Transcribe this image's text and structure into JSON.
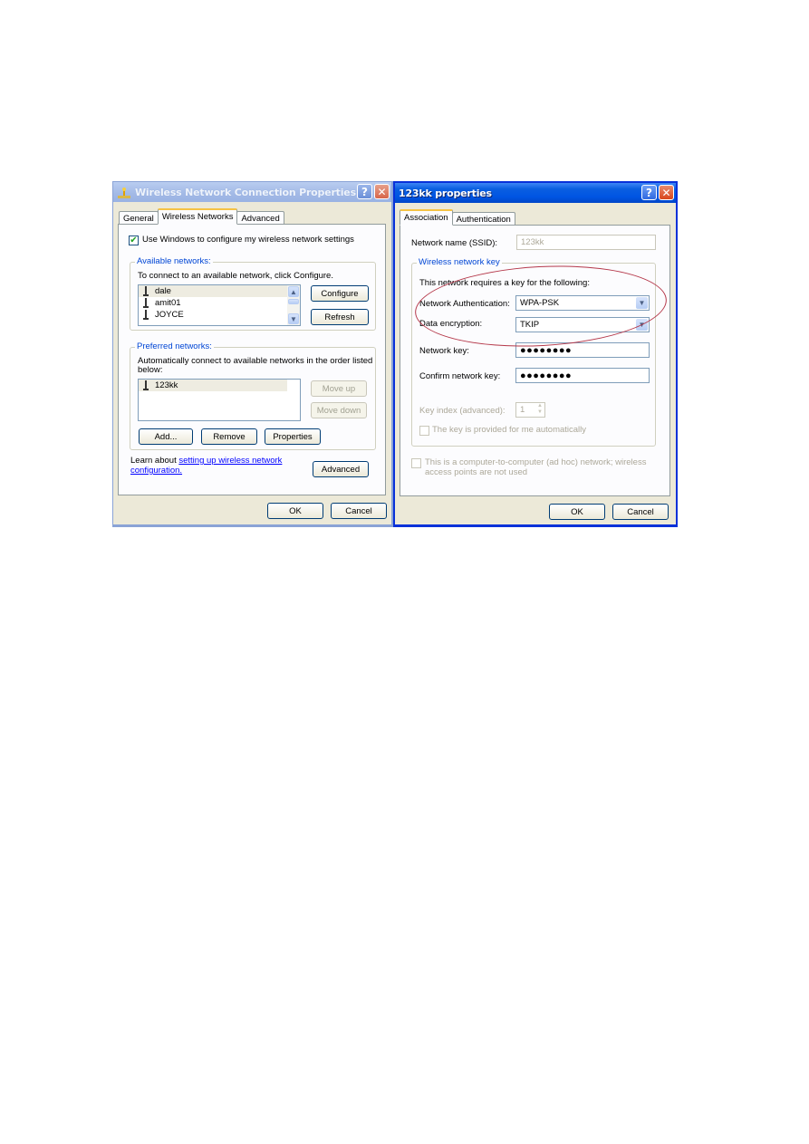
{
  "left_dialog": {
    "title": "Wireless Network Connection Properties",
    "help_label": "?",
    "close_label": "✕",
    "icon": "network-icon",
    "tabs": [
      {
        "label": "General",
        "active": false
      },
      {
        "label": "Wireless Networks",
        "active": true
      },
      {
        "label": "Advanced",
        "active": false
      }
    ],
    "use_windows_checkbox": {
      "label": "Use Windows to configure my wireless network settings",
      "checked": true,
      "mark": "✔"
    },
    "available": {
      "legend": "Available networks:",
      "description": "To connect to an available network, click Configure.",
      "networks": [
        "dale",
        "amit01",
        "JOYCE"
      ],
      "selected_index": 0,
      "configure_label": "Configure",
      "refresh_label": "Refresh"
    },
    "preferred": {
      "legend": "Preferred networks:",
      "description_line1": "Automatically connect to available networks in the order listed",
      "description_line2": "below:",
      "networks": [
        "123kk"
      ],
      "move_up_label": "Move up",
      "move_down_label": "Move down",
      "add_label": "Add...",
      "remove_label": "Remove",
      "properties_label": "Properties"
    },
    "learn_prefix": "Learn about ",
    "learn_link_line1": "setting up wireless network",
    "learn_link_line2": "configuration.",
    "advanced_label": "Advanced",
    "ok_label": "OK",
    "cancel_label": "Cancel"
  },
  "right_dialog": {
    "title": "123kk properties",
    "help_label": "?",
    "close_label": "✕",
    "tabs": [
      {
        "label": "Association",
        "active": true
      },
      {
        "label": "Authentication",
        "active": false
      }
    ],
    "ssid_label": "Network name (SSID):",
    "ssid_value": "123kk",
    "key_group": {
      "legend": "Wireless network key",
      "description": "This network requires a key for the following:",
      "auth_label": "Network Authentication:",
      "auth_value": "WPA-PSK",
      "encryption_label": "Data encryption:",
      "encryption_value": "TKIP",
      "network_key_label": "Network key:",
      "network_key_value": "●●●●●●●●",
      "confirm_key_label": "Confirm network key:",
      "confirm_key_value": "●●●●●●●●",
      "key_index_label": "Key index (advanced):",
      "key_index_value": "1",
      "auto_key_label": "The key is provided for me automatically",
      "auto_key_checked": false
    },
    "adhoc_label_line1": "This is a computer-to-computer (ad hoc) network; wireless",
    "adhoc_label_line2": "access points are not used",
    "adhoc_checked": false,
    "ok_label": "OK",
    "cancel_label": "Cancel"
  },
  "colors": {
    "dialog_bg": "#ece9d8",
    "panel_bg": "#fcfcfe",
    "active_title": "#0054e3",
    "inactive_title": "#a2b9e6",
    "group_legend": "#0046d5",
    "annotation": "#b5384a"
  }
}
